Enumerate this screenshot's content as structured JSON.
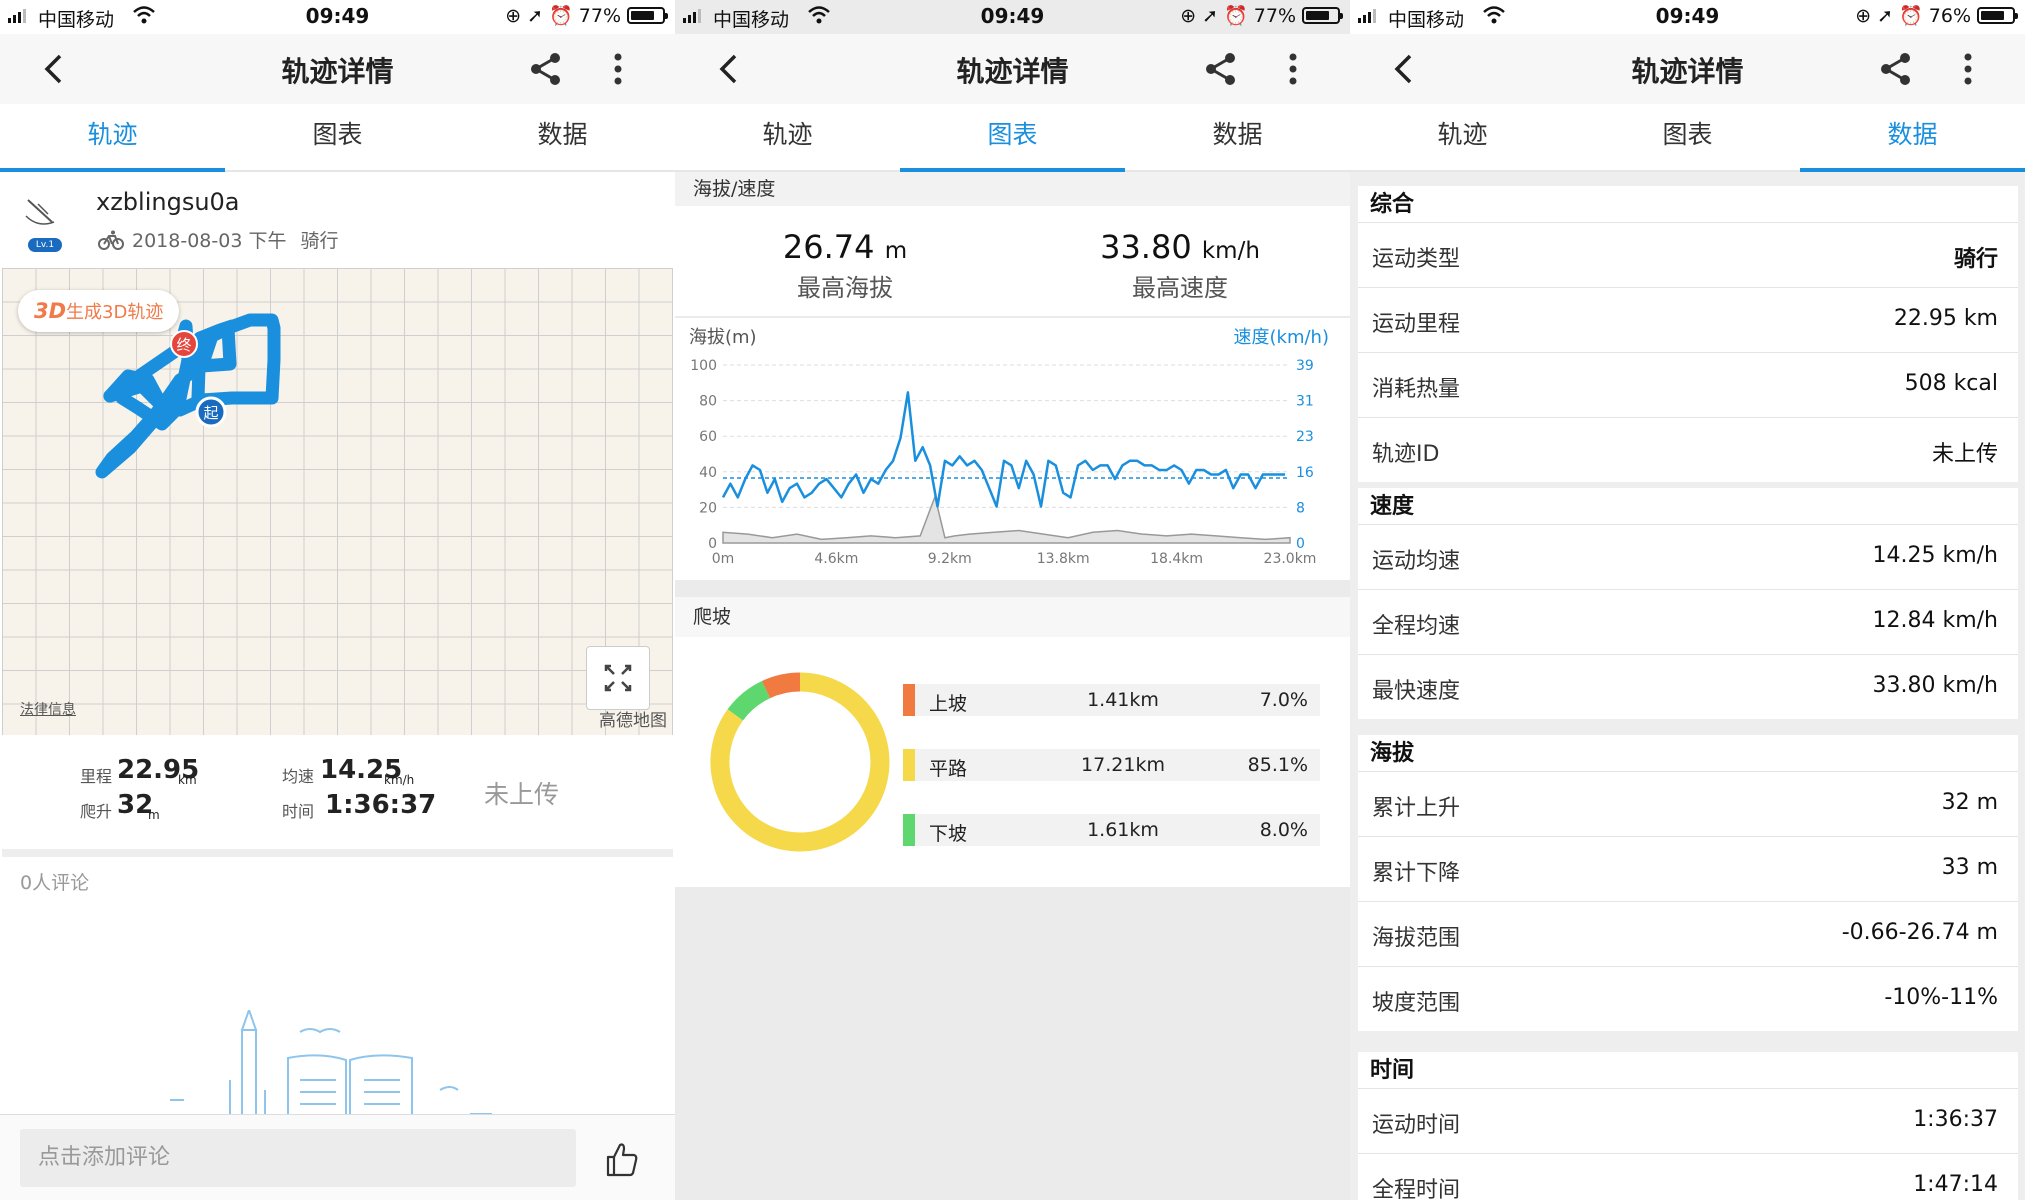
{
  "status": [
    {
      "carrier": "中国移动",
      "time": "09:49",
      "battery": "77%",
      "battery_level": 0.77
    },
    {
      "carrier": "中国移动",
      "time": "09:49",
      "battery": "77%",
      "battery_level": 0.77
    },
    {
      "carrier": "中国移动",
      "time": "09:49",
      "battery": "76%",
      "battery_level": 0.76
    }
  ],
  "header": {
    "title": "轨迹详情"
  },
  "tabs": [
    "轨迹",
    "图表",
    "数据"
  ],
  "panel1": {
    "username": "xzblingsu0a",
    "level": "Lv.1",
    "meta_date": "2018-08-03 下午",
    "meta_type": "骑行",
    "map": {
      "btn3d_prefix": "3D",
      "btn3d_text": "生成3D轨迹",
      "end_marker": "终",
      "start_marker": "起",
      "legal": "法律信息",
      "provider": "高德地图"
    },
    "stats": {
      "distance_label": "里程",
      "distance_value": "22.95",
      "distance_unit": "km",
      "climb_label": "爬升",
      "climb_value": "32",
      "climb_unit": "m",
      "speed_label": "均速",
      "speed_value": "14.25",
      "speed_unit": "km/h",
      "time_label": "时间",
      "time_value": "1:36:37",
      "upload_status": "未上传"
    },
    "comments_count": "0人评论",
    "comment_placeholder": "点击添加评论"
  },
  "panel2": {
    "section_altitude_speed": "海拔/速度",
    "max_altitude_value": "26.74",
    "max_altitude_unit": "m",
    "max_altitude_label": "最高海拔",
    "max_speed_value": "33.80",
    "max_speed_unit": "km/h",
    "max_speed_label": "最高速度",
    "section_climb": "爬坡"
  },
  "chart_data": [
    {
      "type": "line",
      "xlabel": "",
      "ylabel": "海拔(m)",
      "y2label": "速度(km/h)",
      "x_ticks": [
        "0m",
        "4.6km",
        "9.2km",
        "13.8km",
        "18.4km",
        "23.0km"
      ],
      "xlim": [
        0,
        23.0
      ],
      "ylim": [
        0,
        100
      ],
      "y_ticks": [
        "0",
        "20",
        "40",
        "60",
        "80",
        "100"
      ],
      "y2lim": [
        0,
        39
      ],
      "y2_ticks": [
        "0",
        "8",
        "16",
        "23",
        "31",
        "39"
      ],
      "grid": true,
      "series": [
        {
          "name": "速度(km/h)",
          "axis": "right",
          "color": "#1a8fde",
          "x": [
            0,
            0.3,
            0.6,
            0.9,
            1.2,
            1.5,
            1.8,
            2.1,
            2.4,
            2.7,
            3.0,
            3.3,
            3.6,
            3.9,
            4.2,
            4.5,
            4.8,
            5.1,
            5.4,
            5.7,
            6.0,
            6.3,
            6.6,
            6.9,
            7.2,
            7.5,
            7.8,
            8.1,
            8.4,
            8.7,
            9.0,
            9.3,
            9.6,
            9.9,
            10.2,
            10.5,
            10.8,
            11.1,
            11.4,
            11.7,
            12.0,
            12.3,
            12.6,
            12.9,
            13.2,
            13.5,
            13.8,
            14.1,
            14.4,
            14.7,
            15.0,
            15.3,
            15.6,
            15.9,
            16.2,
            16.5,
            16.8,
            17.1,
            17.4,
            17.7,
            18.0,
            18.3,
            18.6,
            18.9,
            19.2,
            19.5,
            19.8,
            20.1,
            20.4,
            20.7,
            21.0,
            21.3,
            21.6,
            21.9,
            22.2,
            22.5,
            22.8
          ],
          "values": [
            10,
            13,
            10,
            14,
            17,
            16,
            11,
            14,
            9,
            12,
            13,
            10,
            11,
            13,
            14,
            12,
            10,
            13,
            15,
            11,
            14,
            13,
            16,
            18,
            23,
            33,
            18,
            21,
            17,
            8,
            18,
            17,
            19,
            17,
            18,
            16,
            12,
            8,
            18,
            17,
            12,
            18,
            15,
            8,
            18,
            17,
            11,
            10,
            17,
            18,
            16,
            17,
            17,
            14,
            17,
            18,
            18,
            17,
            17,
            16,
            16,
            17,
            16,
            13,
            16,
            16,
            15,
            15,
            16,
            12,
            15,
            15,
            12,
            15,
            15,
            15,
            15
          ]
        },
        {
          "name": "海拔(m)",
          "axis": "left",
          "color": "#999999",
          "x": [
            0,
            1,
            2,
            3,
            4,
            5,
            6,
            7,
            8,
            8.6,
            9,
            9.4,
            10,
            11,
            12,
            13,
            14,
            15,
            16,
            17,
            18,
            19,
            20,
            21,
            22,
            23
          ],
          "values": [
            6,
            5,
            3,
            5,
            2,
            3,
            4,
            3,
            4,
            26,
            3,
            4,
            5,
            6,
            7,
            5,
            3,
            6,
            7,
            5,
            4,
            5,
            4,
            3,
            2,
            3
          ]
        }
      ],
      "reference_lines": [
        {
          "axis": "right",
          "value": 14.25,
          "style": "dashed",
          "color": "#1a8fde"
        }
      ]
    },
    {
      "type": "pie",
      "title": "",
      "categories": [
        "上坡",
        "平路",
        "下坡"
      ],
      "distances": [
        "1.41km",
        "17.21km",
        "1.61km"
      ],
      "percents": [
        "7.0%",
        "85.1%",
        "8.0%"
      ],
      "values": [
        7.0,
        85.1,
        8.0
      ],
      "colors": [
        "#f07a40",
        "#f6d94a",
        "#5ed86e"
      ]
    }
  ],
  "panel3": {
    "groups": [
      {
        "title": "综合",
        "rows": [
          {
            "k": "运动类型",
            "v": "骑行"
          },
          {
            "k": "运动里程",
            "v": "22.95 km"
          },
          {
            "k": "消耗热量",
            "v": "508 kcal"
          },
          {
            "k": "轨迹ID",
            "v": "未上传"
          }
        ]
      },
      {
        "title": "速度",
        "rows": [
          {
            "k": "运动均速",
            "v": "14.25 km/h"
          },
          {
            "k": "全程均速",
            "v": "12.84 km/h"
          },
          {
            "k": "最快速度",
            "v": "33.80 km/h"
          }
        ]
      },
      {
        "title": "海拔",
        "rows": [
          {
            "k": "累计上升",
            "v": "32 m"
          },
          {
            "k": "累计下降",
            "v": "33 m"
          },
          {
            "k": "海拔范围",
            "v": "-0.66-26.74 m"
          },
          {
            "k": "坡度范围",
            "v": "-10%-11%"
          }
        ]
      },
      {
        "title": "时间",
        "rows": [
          {
            "k": "运动时间",
            "v": "1:36:37"
          },
          {
            "k": "全程时间",
            "v": "1:47:14"
          }
        ]
      }
    ]
  }
}
